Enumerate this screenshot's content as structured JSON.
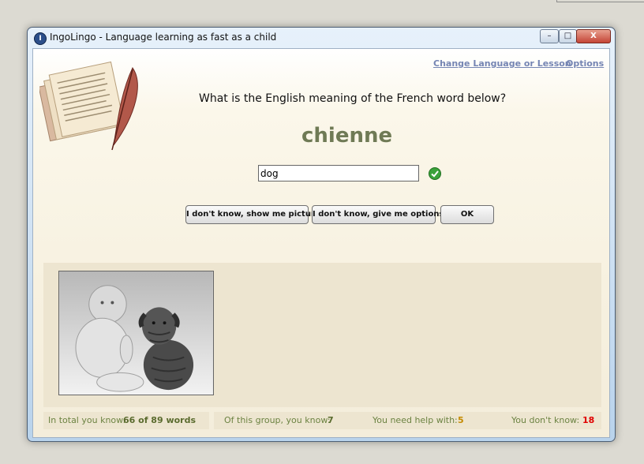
{
  "window": {
    "title": "IngoLingo - Language learning as fast as a child",
    "icon": "ingolingo-app-icon",
    "icon_glyph": "I"
  },
  "controls": {
    "minimize": "–",
    "maximize": "□",
    "close": "X"
  },
  "header": {
    "change_link": "Change Language or Lesson",
    "options_link": "Options"
  },
  "quiz": {
    "question": "What is the English meaning of the French word below?",
    "word": "chienne",
    "answer_value": "dog",
    "answer_status": "correct"
  },
  "buttons": {
    "show_pictures": "I don't know, show me pictures",
    "give_options": "I don't know, give me options",
    "ok": "OK"
  },
  "picture": {
    "subject": "baby sitting next to a wrinkled puppy (black & white photo)"
  },
  "status": {
    "total_label": "In total you know:",
    "total_value": "66 of 89 words",
    "group_label": "Of this group, you know:",
    "group_value": "7",
    "help_label": "You need help with:",
    "help_value": "5",
    "dont_know_label": "You don't know:",
    "dont_know_value": "18"
  },
  "colors": {
    "word": "#6f7a55",
    "link": "#7585b3",
    "status_text": "#6c8342",
    "group_value": "#5a6b2e",
    "help_value": "#c48a00",
    "dont_know_value": "#e00000",
    "correct_icon": "#3aa23a"
  }
}
